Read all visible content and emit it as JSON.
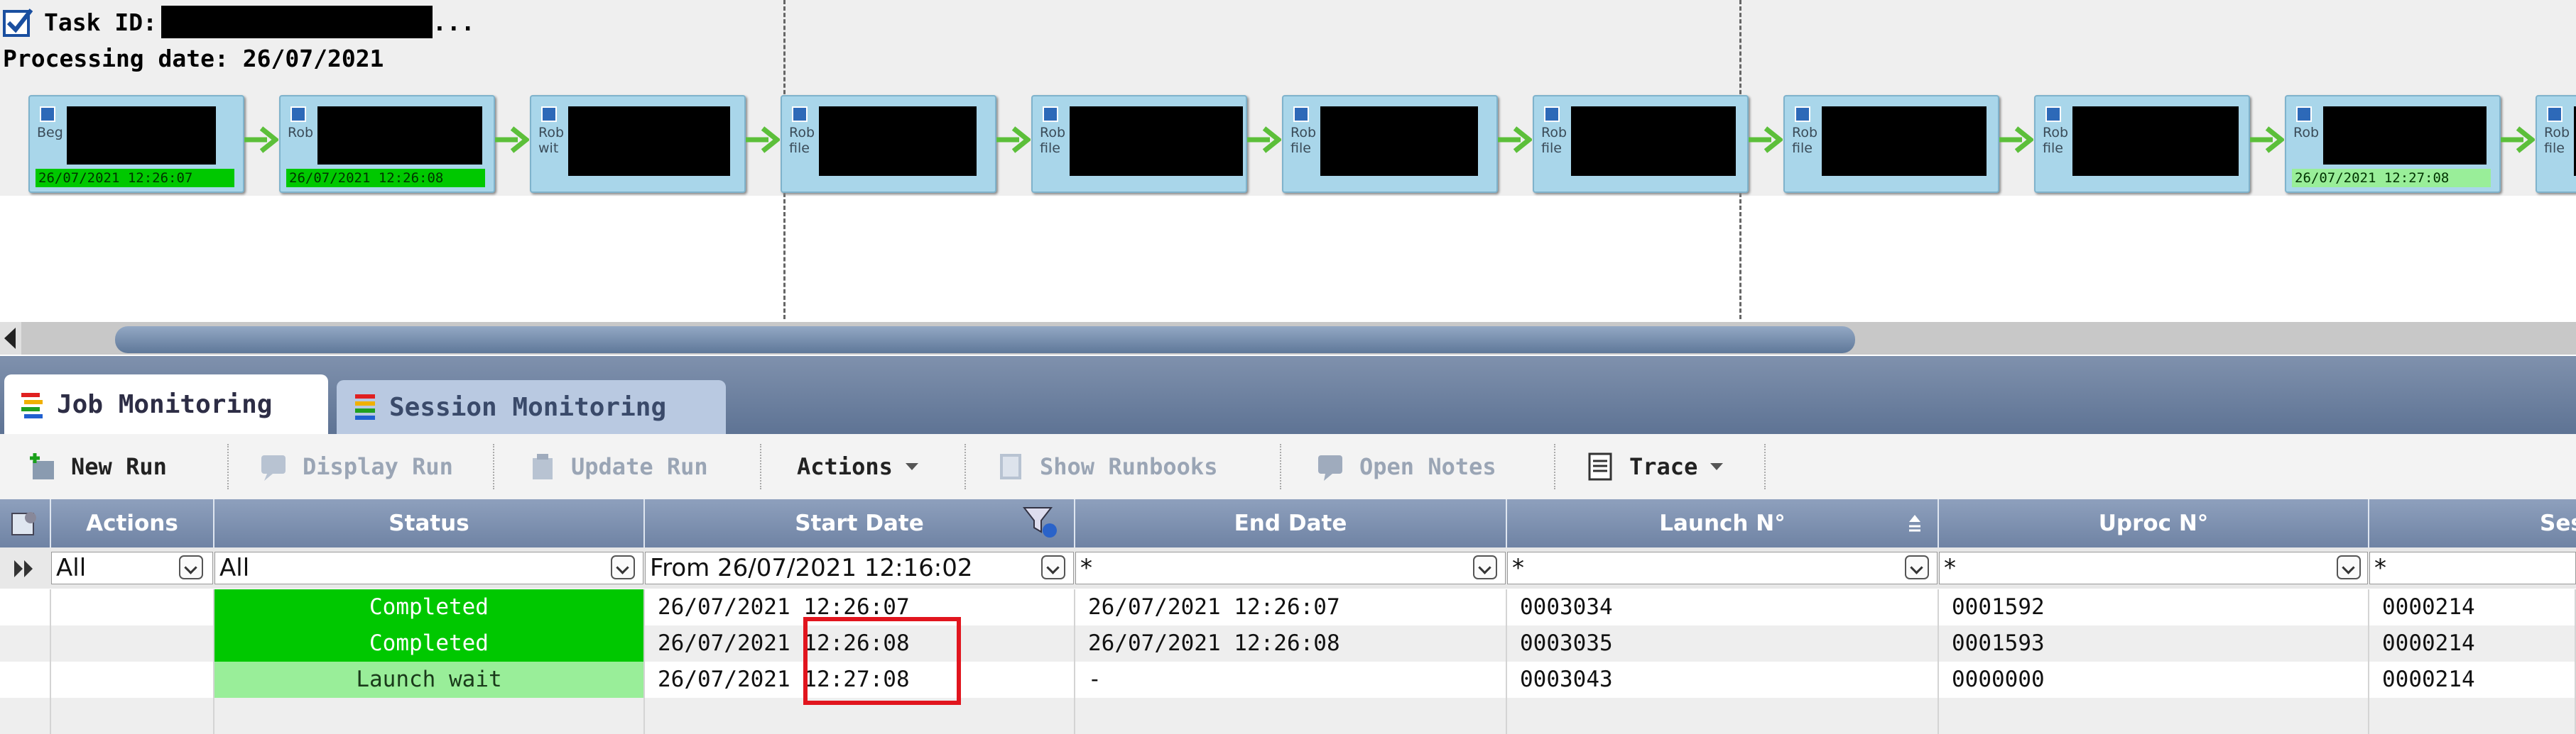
{
  "header": {
    "task_label": "Task ID:",
    "task_suffix": "...",
    "processing_date": "Processing date: 26/07/2021"
  },
  "flow": {
    "nodes": [
      {
        "text": "Beg",
        "time": "26/07/2021 12:26:07",
        "status": "completed"
      },
      {
        "text": "Rob",
        "time": "26/07/2021 12:26:08",
        "status": "completed"
      },
      {
        "text": "Rob\nwit",
        "time": "",
        "status": "none"
      },
      {
        "text": "Rob\nfile",
        "time": "",
        "status": "none"
      },
      {
        "text": "Rob\nfile",
        "time": "",
        "status": "none"
      },
      {
        "text": "Rob\nfile",
        "time": "",
        "status": "none"
      },
      {
        "text": "Rob\nfile",
        "time": "",
        "status": "none"
      },
      {
        "text": "Rob\nfile",
        "time": "",
        "status": "none"
      },
      {
        "text": "Rob\nfile",
        "time": "",
        "status": "none"
      },
      {
        "text": "Rob",
        "time": "26/07/2021 12:27:08",
        "status": "launch-wait"
      },
      {
        "text": "Rob\nfile",
        "time": "",
        "status": "none"
      }
    ]
  },
  "tabs": [
    {
      "label": "Job Monitoring",
      "active": true
    },
    {
      "label": "Session Monitoring",
      "active": false
    }
  ],
  "toolbar": {
    "new_run": "New Run",
    "display_run": "Display Run",
    "update_run": "Update Run",
    "actions": "Actions",
    "show_runbooks": "Show Runbooks",
    "open_notes": "Open Notes",
    "trace": "Trace"
  },
  "grid": {
    "columns": [
      "Actions",
      "Status",
      "Start Date",
      "End Date",
      "Launch N°",
      "Uproc N°",
      "Sess"
    ],
    "filters": [
      "All",
      "All",
      "From 26/07/2021 12:16:02",
      "*",
      "*",
      "*",
      "*"
    ],
    "rows": [
      {
        "status": "Completed",
        "start": "26/07/2021 12:26:07",
        "end": "26/07/2021 12:26:07",
        "launch": "0003034",
        "uproc": "0001592",
        "session": "0000214"
      },
      {
        "status": "Completed",
        "start": "26/07/2021 12:26:08",
        "end": "26/07/2021 12:26:08",
        "launch": "0003035",
        "uproc": "0001593",
        "session": "0000214"
      },
      {
        "status": "Launch wait",
        "start": "26/07/2021 12:27:08",
        "end": "-",
        "launch": "0003043",
        "uproc": "0000000",
        "session": "0000214"
      }
    ]
  },
  "colors": {
    "completed": "#00c800",
    "launch_wait": "#99ee99",
    "highlight_box": "#e1151e",
    "header_blue": "#7f91ad"
  }
}
